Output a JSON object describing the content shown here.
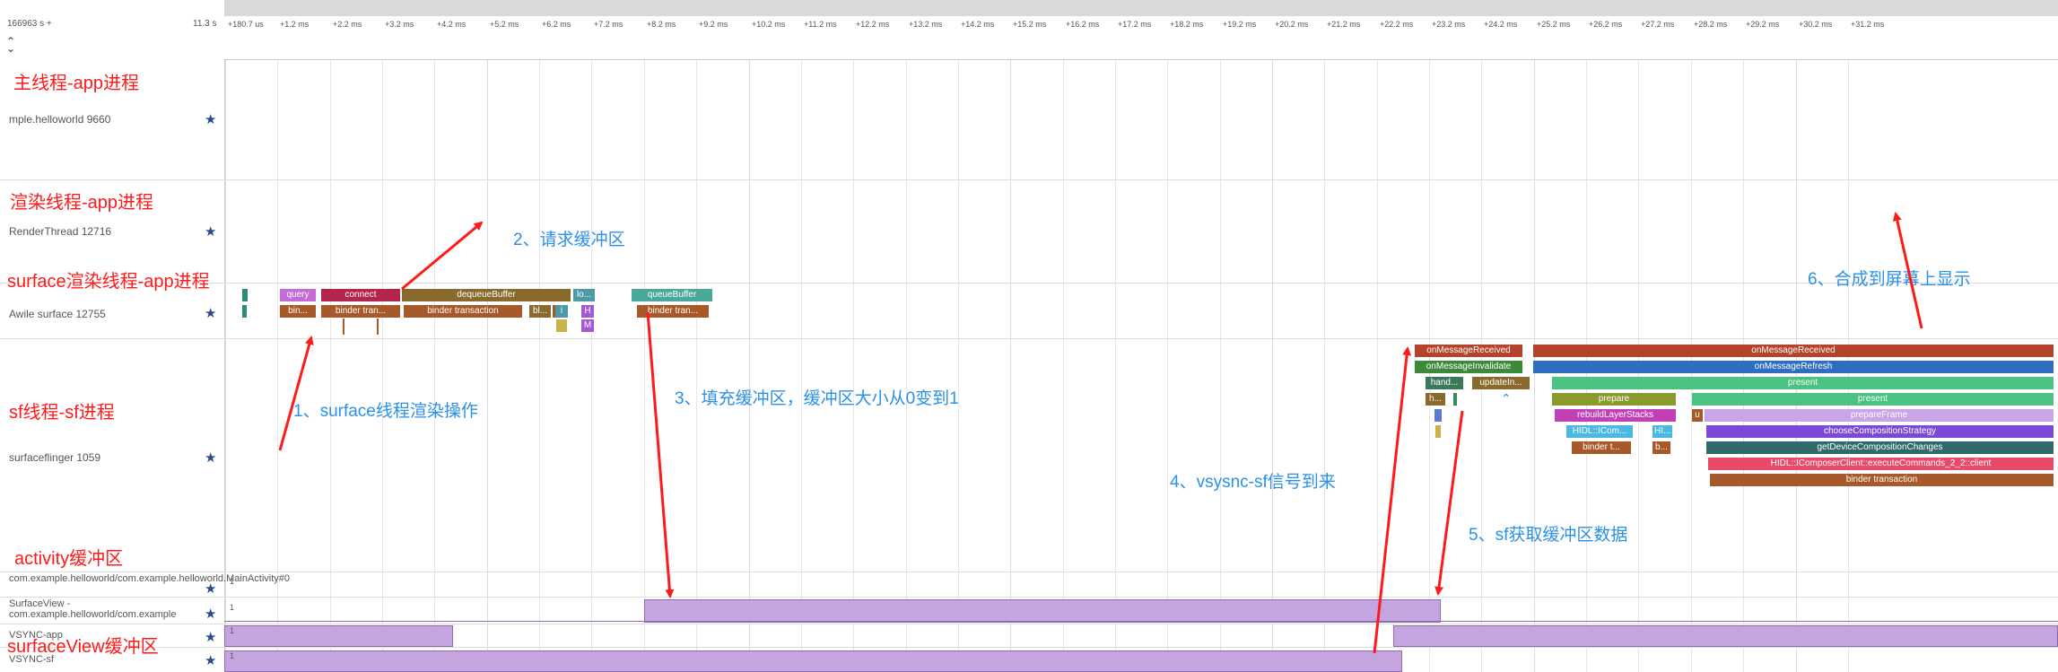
{
  "header": {
    "start_time": "166963 s +",
    "duration": "11.3 s",
    "collapse_icon": "chevron-double-icon"
  },
  "ruler": {
    "ticks": [
      "+180.7 us",
      "+1.2 ms",
      "+2.2 ms",
      "+3.2 ms",
      "+4.2 ms",
      "+5.2 ms",
      "+6.2 ms",
      "+7.2 ms",
      "+8.2 ms",
      "+9.2 ms",
      "+10.2 ms",
      "+11.2 ms",
      "+12.2 ms",
      "+13.2 ms",
      "+14.2 ms",
      "+15.2 ms",
      "+16.2 ms",
      "+17.2 ms",
      "+18.2 ms",
      "+19.2 ms",
      "+20.2 ms",
      "+21.2 ms",
      "+22.2 ms",
      "+23.2 ms",
      "+24.2 ms",
      "+25.2 ms",
      "+26.2 ms",
      "+27.2 ms",
      "+28.2 ms",
      "+29.2 ms",
      "+30.2 ms",
      "+31.2 ms"
    ]
  },
  "tracks": {
    "main": {
      "name": "mple.helloworld 9660"
    },
    "render": {
      "name": "RenderThread 12716"
    },
    "surface": {
      "name": "Awile surface 12755"
    },
    "sf": {
      "name": "surfaceflinger 1059"
    },
    "activity_buf": {
      "name": "com.example.helloworld/com.example.helloworld.MainActivity#0",
      "value": "1"
    },
    "surfaceview_buf": {
      "name": "SurfaceView - com.example.helloworld/com.example",
      "value": "1"
    },
    "vsync_app": {
      "name": "VSYNC-app",
      "value": "1"
    },
    "vsync_sf": {
      "name": "VSYNC-sf",
      "value": "1"
    }
  },
  "slices": {
    "query": "query",
    "bin1": "bin...",
    "connect": "connect",
    "binder_tran": "binder tran...",
    "dequeueBuffer": "dequeueBuffer",
    "binder_transaction": "binder transaction",
    "bl": "bl...",
    "lo": "lo...",
    "i": "i",
    "H": "H",
    "M": "M",
    "queueBuffer": "queueBuffer",
    "binder_tran2": "binder tran...",
    "onMessageReceived1": "onMessageReceived",
    "onMessageInvalidate": "onMessageInvalidate",
    "hand": "hand...",
    "updateIn": "updateIn...",
    "h": "h...",
    "onMessageReceived2": "onMessageReceived",
    "onMessageRefresh": "onMessageRefresh",
    "present1": "present",
    "prepare": "prepare",
    "present2": "present",
    "rebuildLayerStacks": "rebuildLayerStacks",
    "u": "u",
    "prepareFrame": "prepareFrame",
    "HIDL_ICom": "HIDL::ICom...",
    "HI": "HI...",
    "chooseCompositionStrategy": "chooseCompositionStrategy",
    "binder_t": "binder t...",
    "b": "b...",
    "getDeviceCompositionChanges": "getDeviceCompositionChanges",
    "executeCommands": "HIDL::IComposerClient::executeCommands_2_2::client",
    "binder_transaction2": "binder transaction"
  },
  "annotations": {
    "main_thread": "主线程-app进程",
    "render_thread": "渲染线程-app进程",
    "surface_thread": "surface渲染线程-app进程",
    "sf_thread": "sf线程-sf进程",
    "activity_buffer": "activity缓冲区",
    "surfaceview_buffer": "surfaceView缓冲区",
    "step1": "1、surface线程渲染操作",
    "step2": "2、请求缓冲区",
    "step3": "3、填充缓冲区，缓冲区大小从0变到1",
    "step4": "4、vsysnc-sf信号到来",
    "step5": "5、sf获取缓冲区数据",
    "step6": "6、合成到屏幕上显示"
  },
  "colors": {
    "annotation_red": "#ff1a1a",
    "annotation_blue": "#2b90e8",
    "counter_fill": "#c4a5e0"
  }
}
